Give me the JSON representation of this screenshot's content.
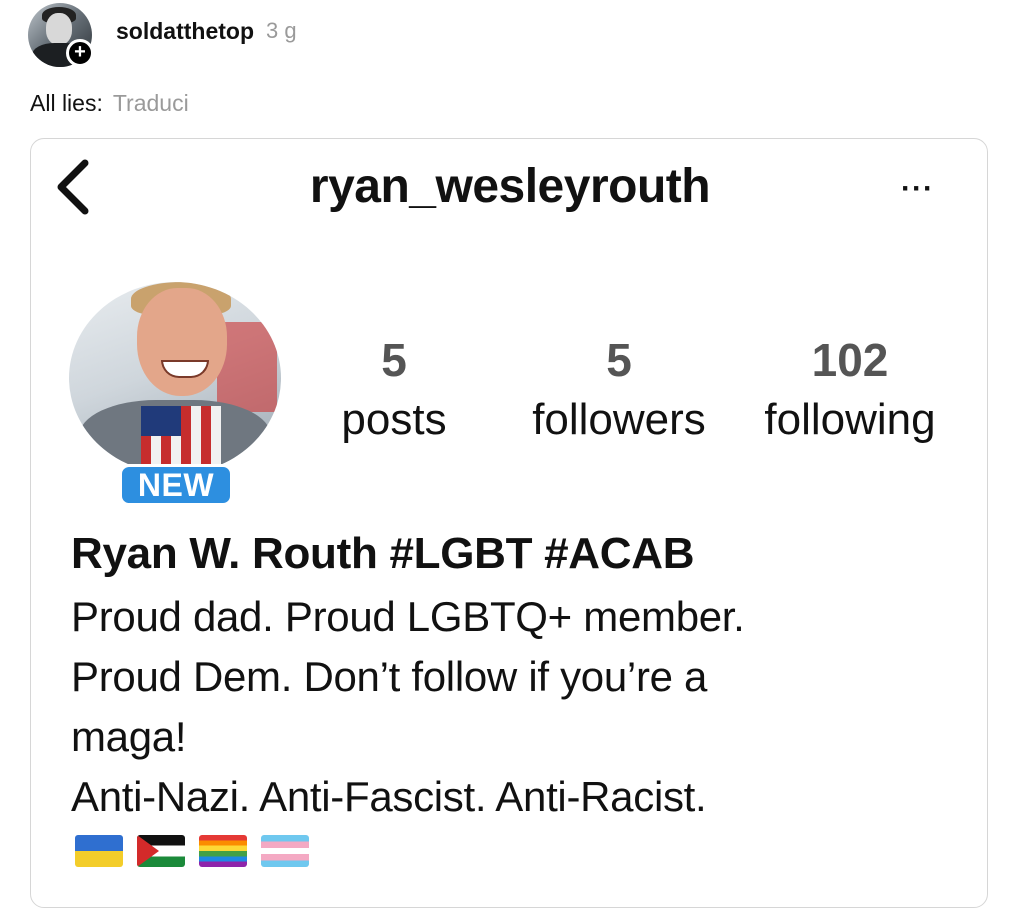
{
  "post": {
    "username": "soldatthetop",
    "timestamp": "3 g",
    "caption": "All lies:",
    "translate_label": "Traduci",
    "avatar_badge_glyph": "+"
  },
  "embedded_profile": {
    "handle": "ryan_wesleyrouth",
    "back_icon": "chevron-left-icon",
    "more_glyph": "···",
    "badge": "NEW",
    "stats": {
      "posts": {
        "value": "5",
        "label": "posts"
      },
      "followers": {
        "value": "5",
        "label": "followers"
      },
      "following": {
        "value": "102",
        "label": "following"
      }
    },
    "display_name": "Ryan W. Routh #LGBT #ACAB",
    "bio_lines": [
      "Proud dad. Proud LGBTQ+ member.",
      "Proud Dem. Don’t follow if you’re a",
      "maga!",
      "Anti-Nazi. Anti-Fascist. Anti-Racist."
    ],
    "flags": [
      "ukraine-flag-icon",
      "palestine-flag-icon",
      "rainbow-flag-icon",
      "transgender-flag-icon"
    ]
  },
  "colors": {
    "badge_blue": "#2d8fe0",
    "muted_text": "#9a9a9a",
    "stat_number": "#555555",
    "border": "#d6d6d6"
  }
}
